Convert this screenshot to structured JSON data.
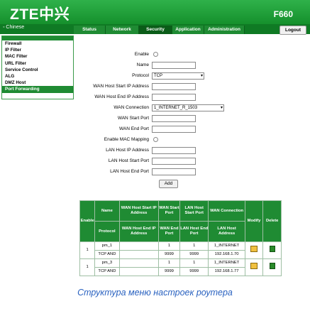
{
  "brand": {
    "logo": "ZTE中兴",
    "model": "F660"
  },
  "menu": {
    "language": "◦ Chinese",
    "tabs": [
      "Status",
      "Network",
      "Security",
      "Application",
      "Administration"
    ],
    "active_tab": "Security",
    "logout": "Logout"
  },
  "sidebar": {
    "items": [
      "Firewall",
      "IP Filter",
      "MAC Filter",
      "URL Filter",
      "Service Control",
      "ALG",
      "DMZ Host",
      "Port Forwarding"
    ],
    "active": "Port Forwarding"
  },
  "form": {
    "enable_label": "Enable",
    "name_label": "Name",
    "protocol_label": "Protocol",
    "protocol_value": "TCP",
    "wan_host_start_label": "WAN Host Start IP Address",
    "wan_host_end_label": "WAN Host End IP Address",
    "wan_connection_label": "WAN Connection",
    "wan_connection_value": "1_INTERNET_R_1503",
    "wan_start_port_label": "WAN Start Port",
    "wan_end_port_label": "WAN End Port",
    "enable_mac_label": "Enable MAC Mapping",
    "lan_host_ip_label": "LAN Host IP Address",
    "lan_host_start_port_label": "LAN Host Start Port",
    "lan_host_end_port_label": "LAN Host End Port",
    "add_button": "Add"
  },
  "table": {
    "headers": {
      "enable": "Enable",
      "name": "Name",
      "protocol": "Protocol",
      "wan_start_ip": "WAN Host Start IP Address",
      "wan_end_ip": "WAN Host End IP Address",
      "wan_start_port": "WAN Start Port",
      "wan_end_port": "WAN End Port",
      "lan_start_port": "LAN Host Start Port",
      "lan_end_port": "LAN Host End Port",
      "wan_connection": "WAN Connection",
      "lan_host_address": "LAN Host Address",
      "modify": "Modify",
      "delete": "Delete"
    },
    "rows": [
      {
        "enable": "1",
        "name": "pm_1",
        "protocol": "TCP AND",
        "wan_start_ip": "",
        "wan_end_ip": "",
        "wan_start_port": "1",
        "wan_end_port": "9999",
        "lan_start_port": "1",
        "lan_end_port": "9999",
        "wan_connection": "1_INTERNET",
        "lan_host": "192.168.1.70"
      },
      {
        "enable": "1",
        "name": "pm_3",
        "protocol": "TCP AND",
        "wan_start_ip": "",
        "wan_end_ip": "",
        "wan_start_port": "1",
        "wan_end_port": "9999",
        "lan_start_port": "1",
        "lan_end_port": "9999",
        "wan_connection": "1_INTERNET",
        "lan_host": "192.168.1.77"
      }
    ]
  },
  "caption": "Структура меню настроек роутера"
}
